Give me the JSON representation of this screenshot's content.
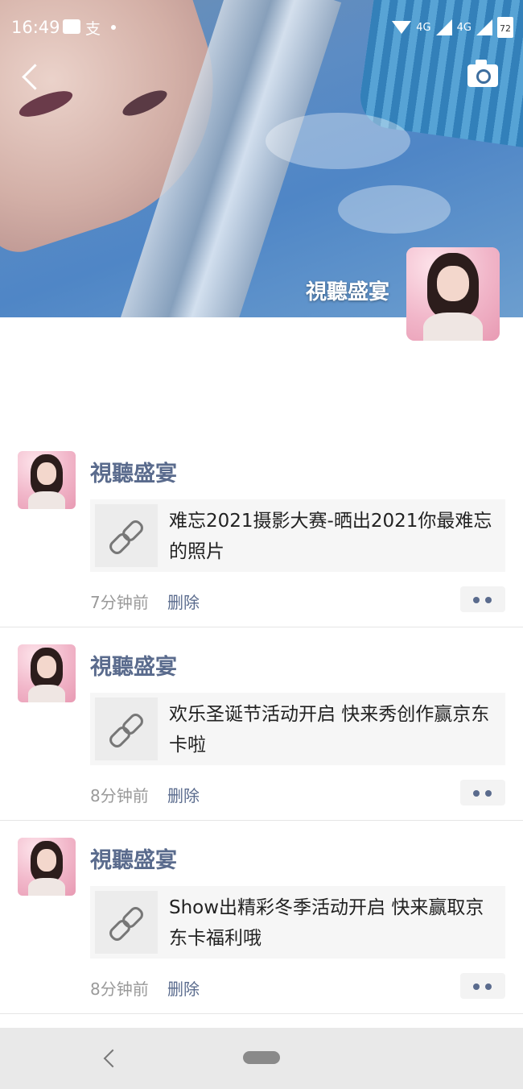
{
  "status_bar": {
    "time": "16:49",
    "notification_icons": [
      "message-icon",
      "alipay-icon"
    ],
    "network_1": "4G",
    "network_2": "4G",
    "battery": "72"
  },
  "header": {
    "back_icon": "chevron-left-icon",
    "camera_icon": "camera-icon",
    "profile_name": "視聽盛宴"
  },
  "posts": [
    {
      "author": "視聽盛宴",
      "title": "难忘2021摄影大赛-晒出2021你最难忘的照片",
      "time": "7分钟前",
      "delete": "删除"
    },
    {
      "author": "視聽盛宴",
      "title": "欢乐圣诞节活动开启 快来秀创作赢京东卡啦",
      "time": "8分钟前",
      "delete": "删除"
    },
    {
      "author": "視聽盛宴",
      "title": "Show出精彩冬季活动开启 快来赢取京东卡福利哦",
      "time": "8分钟前",
      "delete": "删除"
    }
  ],
  "colors": {
    "name_blue": "#5a6b8d",
    "card_bg": "#f6f6f6",
    "muted": "#9a9a9a"
  }
}
